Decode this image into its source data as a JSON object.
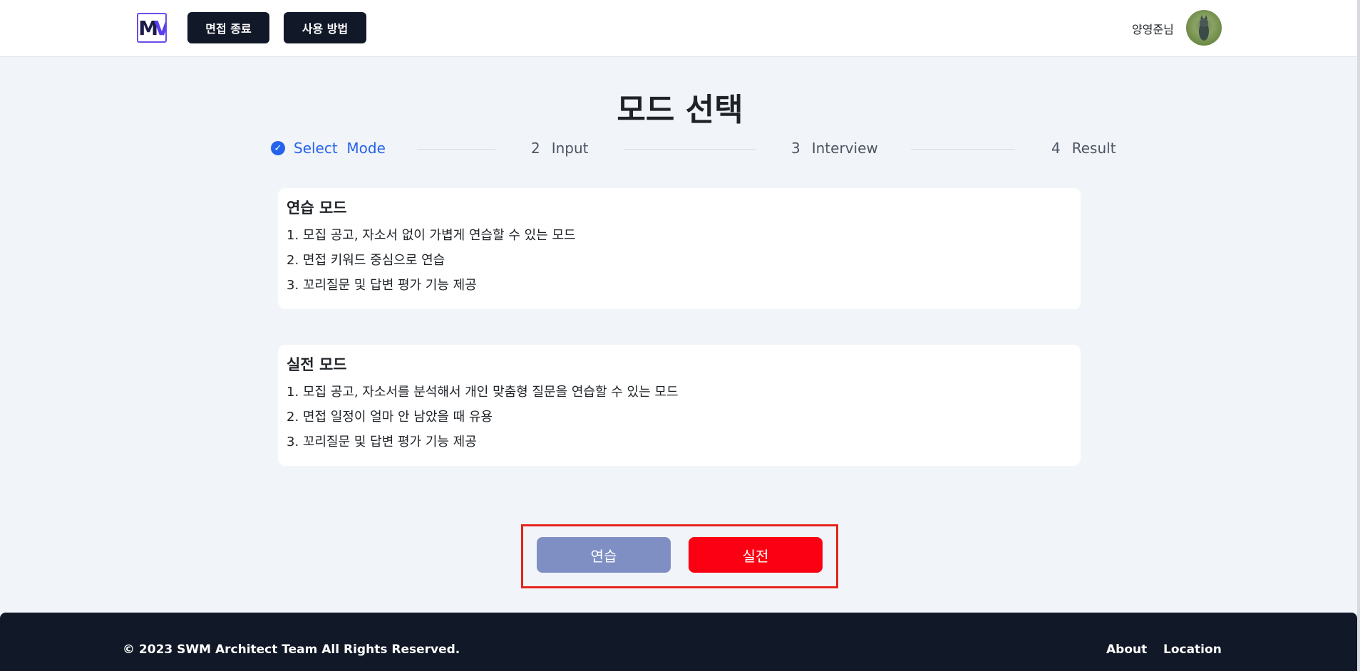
{
  "header": {
    "logo_text_m": "M",
    "logo_text_v": "V",
    "end_interview_label": "면접 종료",
    "how_to_label": "사용 방법",
    "user_name": "양영준님"
  },
  "page": {
    "title": "모드 선택"
  },
  "steps": [
    {
      "number": "",
      "label": "Select  Mode",
      "state": "active"
    },
    {
      "number": "2",
      "label": "Input",
      "state": "pending"
    },
    {
      "number": "3",
      "label": "Interview",
      "state": "pending"
    },
    {
      "number": "4",
      "label": "Result",
      "state": "pending"
    }
  ],
  "modes": {
    "practice": {
      "title": "연습 모드",
      "items": [
        "1. 모집 공고, 자소서 없이 가볍게 연습할 수 있는 모드",
        "2. 면접 키워드 중심으로 연습",
        "3. 꼬리질문 및 답변 평가 기능 제공"
      ]
    },
    "real": {
      "title": "실전 모드",
      "items": [
        "1. 모집 공고, 자소서를 분석해서 개인 맞춤형 질문을 연습할 수 있는 모드",
        "2. 면접 일정이 얼마 안 남았을 때 유용",
        "3. 꼬리질문 및 답변 평가 기능 제공"
      ]
    }
  },
  "actions": {
    "practice_label": "연습",
    "real_label": "실전",
    "practice_color": "#7f8fc4",
    "real_color": "#fb0013",
    "highlight_color": "#e6241c"
  },
  "footer": {
    "copyright": "© 2023 SWM Architect Team All Rights Reserved.",
    "about_label": "About",
    "location_label": "Location"
  },
  "icons": {
    "step_done": "check-circle-icon"
  }
}
